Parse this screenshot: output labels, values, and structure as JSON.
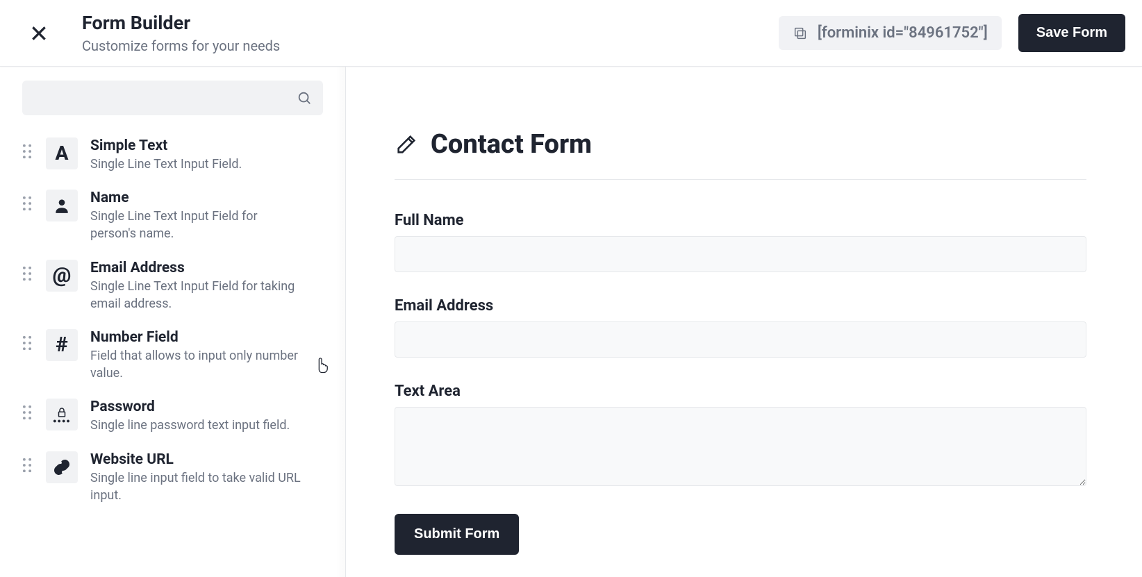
{
  "header": {
    "title": "Form Builder",
    "subtitle": "Customize forms for your needs",
    "shortcode": "[forminix id=\"84961752\"]",
    "save_label": "Save Form"
  },
  "sidebar": {
    "search_placeholder": "",
    "fields": [
      {
        "icon": "A",
        "title": "Simple Text",
        "desc": "Single Line Text Input Field."
      },
      {
        "icon": "user",
        "title": "Name",
        "desc": "Single Line Text Input Field for person's name."
      },
      {
        "icon": "at",
        "title": "Email Address",
        "desc": "Single Line Text Input Field for taking email address."
      },
      {
        "icon": "hash",
        "title": "Number Field",
        "desc": "Field that allows to input only number value."
      },
      {
        "icon": "lock",
        "title": "Password",
        "desc": "Single line password text input field."
      },
      {
        "icon": "link",
        "title": "Website URL",
        "desc": "Single line input field to take valid URL input."
      }
    ]
  },
  "form": {
    "title": "Contact Form",
    "fields": [
      {
        "label": "Full Name",
        "type": "text"
      },
      {
        "label": "Email Address",
        "type": "text"
      },
      {
        "label": "Text Area",
        "type": "textarea"
      }
    ],
    "submit_label": "Submit Form"
  }
}
